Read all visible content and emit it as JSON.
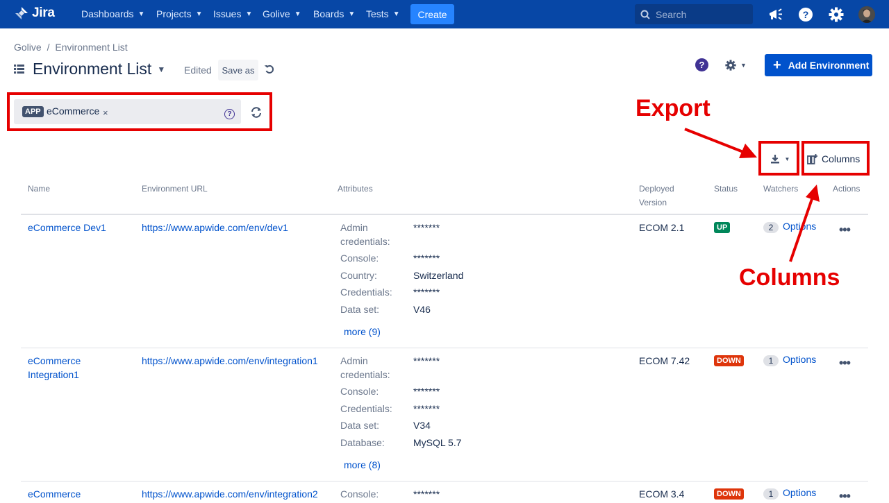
{
  "topnav": {
    "logo": "Jira",
    "items": [
      {
        "label": "Dashboards"
      },
      {
        "label": "Projects"
      },
      {
        "label": "Issues"
      },
      {
        "label": "Golive"
      },
      {
        "label": "Boards"
      },
      {
        "label": "Tests"
      }
    ],
    "create_label": "Create",
    "search_placeholder": "Search",
    "colors": {
      "bar": "#0747a6",
      "create": "#2684ff"
    }
  },
  "header": {
    "breadcrumb": [
      "Golive",
      "Environment List"
    ],
    "breadcrumb_sep": "/",
    "title": "Environment List",
    "edited": "Edited",
    "save_as": "Save as",
    "help": "?",
    "add_environment": "Add Environment"
  },
  "filter": {
    "chip_type": "APP",
    "chip_value": "eCommerce",
    "chip_remove": "×",
    "help": "?"
  },
  "annotations": {
    "export": "Export",
    "columns": "Columns",
    "color": "#e60000"
  },
  "toolbar": {
    "columns_label": "Columns"
  },
  "table": {
    "headers": {
      "name": "Name",
      "url": "Environment URL",
      "attributes": "Attributes",
      "deployed_1": "Deployed",
      "deployed_2": "Version",
      "status": "Status",
      "watchers": "Watchers",
      "actions": "Actions"
    },
    "rows": [
      {
        "name_1": "eCommerce Dev1",
        "name_2": "",
        "url": "https://www.apwide.com/env/dev1",
        "attributes": [
          {
            "k": "Admin credentials:",
            "v": "*******"
          },
          {
            "k": "Console:",
            "v": "*******"
          },
          {
            "k": "Country:",
            "v": "Switzerland"
          },
          {
            "k": "Credentials:",
            "v": "*******"
          },
          {
            "k": "Data set:",
            "v": "V46"
          }
        ],
        "more": "more (9)",
        "version": "ECOM 2.1",
        "status": "UP",
        "watchers": "2",
        "options": "Options"
      },
      {
        "name_1": "eCommerce",
        "name_2": "Integration1",
        "url": "https://www.apwide.com/env/integration1",
        "attributes": [
          {
            "k": "Admin credentials:",
            "v": "*******"
          },
          {
            "k": "Console:",
            "v": "*******"
          },
          {
            "k": "Credentials:",
            "v": "*******"
          },
          {
            "k": "Data set:",
            "v": "V34"
          },
          {
            "k": "Database:",
            "v": "MySQL 5.7"
          }
        ],
        "more": "more (8)",
        "version": "ECOM 7.42",
        "status": "DOWN",
        "watchers": "1",
        "options": "Options"
      },
      {
        "name_1": "eCommerce",
        "name_2": "",
        "url": "https://www.apwide.com/env/integration2",
        "attributes": [
          {
            "k": "Console:",
            "v": "*******"
          }
        ],
        "more": "",
        "version": "ECOM 3.4",
        "status": "DOWN",
        "watchers": "1",
        "options": "Options"
      }
    ],
    "status_colors": {
      "UP": "#00875a",
      "DOWN": "#de350b"
    }
  }
}
